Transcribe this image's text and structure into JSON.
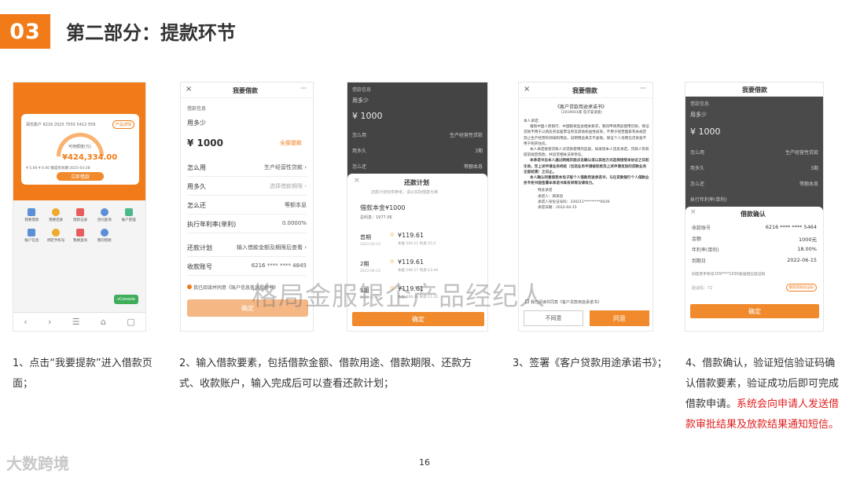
{
  "header": {
    "badge": "03",
    "title": "第二部分：提款环节"
  },
  "screen1": {
    "card_account": "郑氏账户 6216 2025 7555 5412 559",
    "card_badge": "产品详情",
    "available_label": "可用额度(元)",
    "available_amount": "¥424,334.00",
    "rate_info": "¥ 5.00 ¥ 0.00 额度有效期 2025-03-28",
    "withdraw_button": "立即借款",
    "grid_icons": [
      "我要借款",
      "我要还款",
      "借款记录",
      "合同查询",
      "账户管理",
      "账户信息",
      "绑定手机号",
      "我要查询",
      "我的借款"
    ],
    "float_button": "vConsole"
  },
  "screen2": {
    "nav_title": "我要借款",
    "section_label": "借款信息",
    "how_much": "用多少",
    "amount": "¥ 1000",
    "all_borrow": "全部提款",
    "rows": [
      {
        "label": "怎么用",
        "value": "生产经营性贷款 ›"
      },
      {
        "label": "用多久",
        "value": "选择借款期限 ›"
      },
      {
        "label": "怎么还",
        "value": "等额本息"
      },
      {
        "label": "执行年利率(单利)",
        "value": "0.0000%"
      },
      {
        "label": "还款计划",
        "value": "输入借款金额及期限后查看 ›"
      },
      {
        "label": "收款账号",
        "value": "6216 **** **** 4845"
      }
    ],
    "agree_text": "我已阅读并同意《账户信息查询授权书》",
    "confirm_button": "确定"
  },
  "screen3": {
    "bg_section": "借款信息",
    "bg_how_much": "用多少",
    "bg_amount": "¥ 1000",
    "bg_rows": [
      {
        "label": "怎么用",
        "value": "生产经营性贷款"
      },
      {
        "label": "用多久",
        "value": "3期"
      },
      {
        "label": "怎么还",
        "value": "等额本息"
      }
    ],
    "sheet_title": "还款计划",
    "sheet_note": "还款计划仅供参考，请以实际借款为准",
    "principal": "借款本金¥1000",
    "total_interest": "总利息：1977.06",
    "periods": [
      {
        "name": "首期",
        "date": "2022-05-15",
        "amount": "¥119.61",
        "detail": "本金:104.11 利息:15.5"
      },
      {
        "name": "2期",
        "date": "2022-06-15",
        "amount": "¥119.61",
        "detail": "本金:106.17 利息:13.44"
      },
      {
        "name": "3期",
        "date": "2022-07-15",
        "amount": "¥119.61",
        "detail": "本金:108.26 利息:11.35"
      }
    ],
    "sheet_button": "确定"
  },
  "screen4": {
    "nav_title": "我要借款",
    "doc_title": "《客户贷款用途承诺书》",
    "doc_no": "(2019001版 电子渠道版)",
    "doc_para1": "本人承诺：",
    "doc_para2": "遵照中国人民银行、中国银保监会相关要求，我同申请用途使用贷款，保证贷款不用于以购房买卖股票证券及其他权益性投资，不用于经营国家有关规定禁止生产经营的领域和用途，说明用途真实不虚假。保证个人消费信贷资金不用于购买住房。",
    "doc_para3": "本人承诺接受贷款人对贷款使用的监督。如发现本人违反承诺，贷款人有权提前收回借款，并追究相关法律责任。",
    "doc_para4": "本承诺书自本人通过网络页面点击确认或以其他方式选择接受本协议之日起生效，至上述申请业务终结（包括业务申请被拒绝及上述申请发放的贷款业务全部结清）之日止。",
    "doc_para5": "本人确认同意接受本电子版个人借款用途承诺书，与在贷款银行个人借款业务专柜书面签署本承诺书具有同等法律效力。",
    "doc_sign1": "特此承诺",
    "doc_sign2": "承诺人：郑泽昌",
    "doc_sign3": "承诺人身份证号码：330211*********0039",
    "doc_sign4": "承诺日期：2022-04-15",
    "agree_text": "我已阅读并同意《客户贷款用途承诺书》",
    "btn_disagree": "不同意",
    "btn_agree": "同意"
  },
  "screen5": {
    "nav_title": "我要借款",
    "bg_section": "借款信息",
    "bg_how_much": "用多少",
    "bg_amount": "¥ 1000",
    "bg_rows": [
      {
        "label": "怎么用",
        "value": "生产经营性贷款"
      },
      {
        "label": "用多久",
        "value": "3期"
      },
      {
        "label": "怎么还",
        "value": "等额本息"
      },
      {
        "label": "执行年利率(单利)",
        "value": ""
      }
    ],
    "confirm_title": "借款确认",
    "confirm_rows": [
      {
        "label": "收款账号",
        "value": "6216 **** **** 5464"
      },
      {
        "label": "金额",
        "value": "1000元"
      },
      {
        "label": "年利率(单利)",
        "value": "18.00%"
      },
      {
        "label": "到期日",
        "value": "2022-06-15"
      }
    ],
    "sms_hint": "向您的手机号159****1030发送短信验证码",
    "sms_code": "验证码：72",
    "sms_button": "重新获取验证码",
    "confirm_button": "确定"
  },
  "captions": {
    "c1": "1、点击“我要提款”进入借款页面；",
    "c2": "2、输入借款要素，包括借款金额、借款用途、借款期限、还款方式、收款账户，输入完成后可以查看还款计划；",
    "c3": "3、签署《客户贷款用途承诺书》；",
    "c4_normal": "4、借款确认，验证短信验证码确认借款要素，验证成功后即可完成借款申请。",
    "c4_red": "系统会向申请人发送借款审批结果及放款结果通知短信。"
  },
  "watermark": "格局金服银企产品经纪人",
  "page_number": "16",
  "logo_text": "大数跨境"
}
